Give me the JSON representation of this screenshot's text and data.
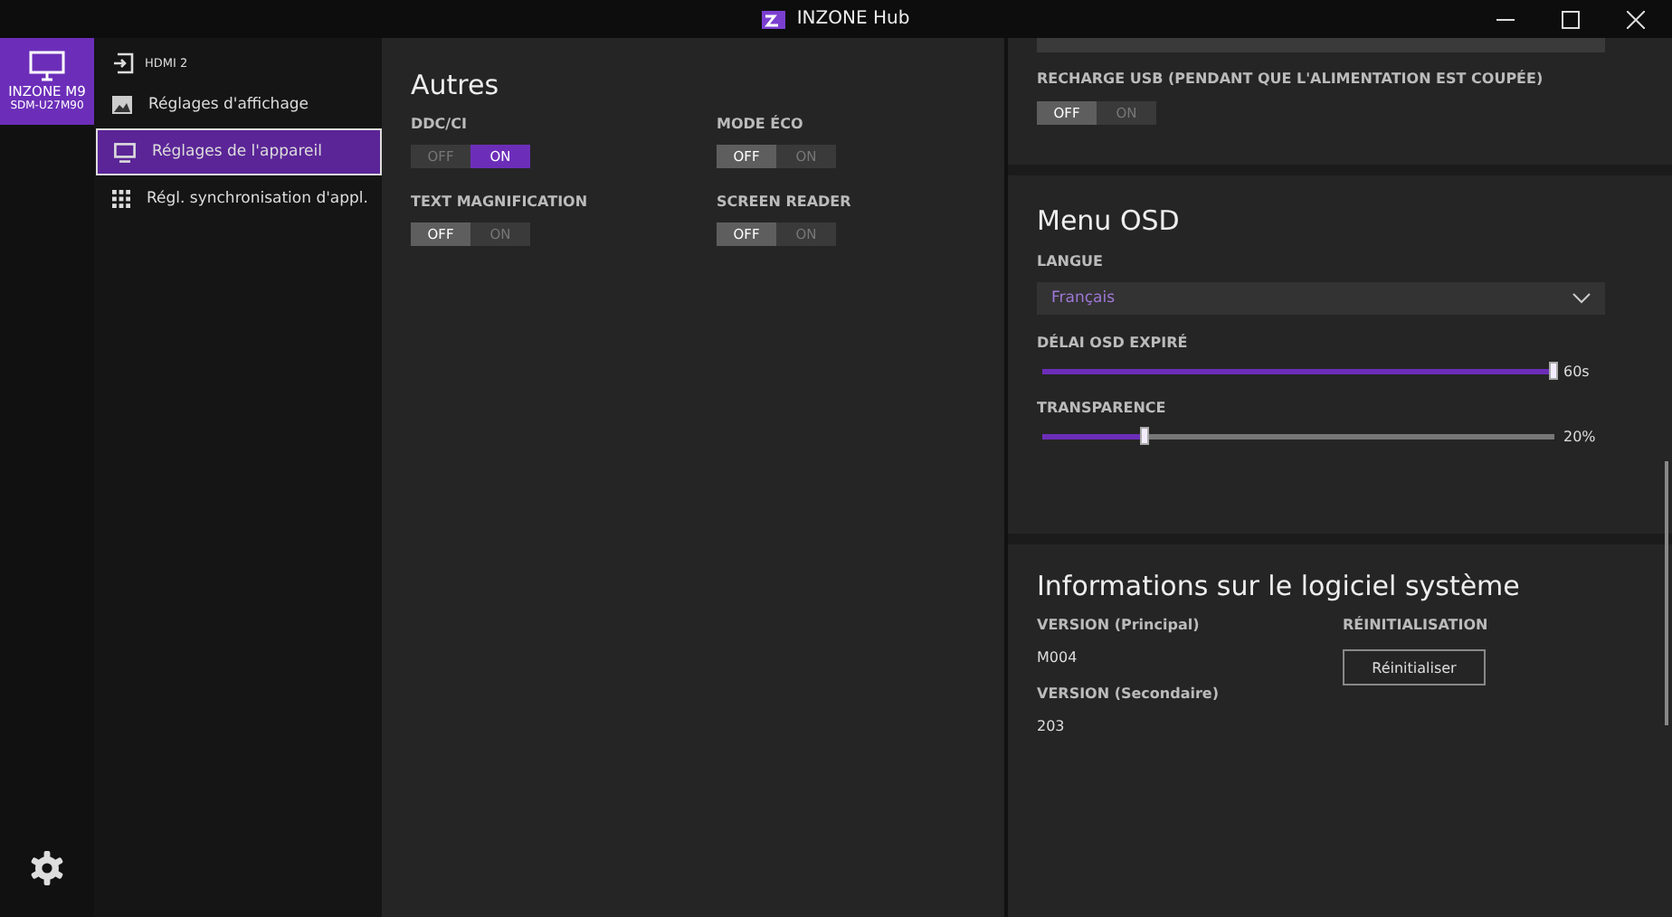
{
  "window": {
    "title": "INZONE Hub"
  },
  "device": {
    "name": "INZONE M9",
    "model": "SDM-U27M90"
  },
  "sidebar": {
    "items": [
      {
        "kind": "input",
        "label": "HDMI 2",
        "selected": false
      },
      {
        "kind": "image",
        "label": "Réglages d'affichage",
        "selected": false
      },
      {
        "kind": "monitor",
        "label": "Réglages de l'appareil",
        "selected": true
      },
      {
        "kind": "grid",
        "label": "Régl. synchronisation d'appl.",
        "selected": false
      }
    ]
  },
  "autres": {
    "title": "Autres",
    "toggles": [
      {
        "label": "DDC/CI",
        "off": "OFF",
        "on_label": "ON",
        "on": true
      },
      {
        "label": "MODE ÉCO",
        "off": "OFF",
        "on_label": "ON",
        "on": false
      },
      {
        "label": "TEXT MAGNIFICATION",
        "off": "OFF",
        "on_label": "ON",
        "on": false
      },
      {
        "label": "SCREEN READER",
        "off": "OFF",
        "on_label": "ON",
        "on": false
      }
    ]
  },
  "usb": {
    "label": "RECHARGE USB (PENDANT QUE L'ALIMENTATION EST COUPÉE)",
    "off": "OFF",
    "on_label": "ON",
    "on": false
  },
  "osd": {
    "title": "Menu OSD",
    "language_label": "LANGUE",
    "language": "Français",
    "sliders": [
      {
        "label": "DÉLAI OSD EXPIRÉ",
        "level": 1.0,
        "reading": "60s"
      },
      {
        "label": "TRANSPARENCE",
        "level": 0.2,
        "reading": "20%"
      }
    ]
  },
  "info": {
    "title": "Informations sur le logiciel système",
    "versions": [
      {
        "label": "VERSION (Principal)",
        "value": "M004"
      },
      {
        "label": "VERSION (Secondaire)",
        "value": "203"
      }
    ],
    "reset_label": "RÉINITIALISATION",
    "reset_button": "Réinitialiser"
  }
}
